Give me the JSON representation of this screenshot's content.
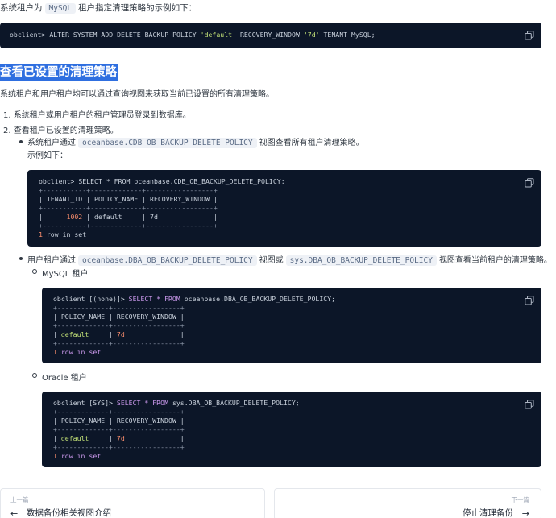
{
  "intro": {
    "prefix": "系统租户为",
    "code": "MySQL",
    "suffix": "租户指定清理策略的示例如下："
  },
  "code1": {
    "prompt": "obclient>",
    "sql": "ALTER SYSTEM ADD DELETE BACKUP POLICY",
    "str1": "'default'",
    "mid": "RECOVERY_WINDOW",
    "str2": "'7d'",
    "tail": "TENANT MySQL;"
  },
  "section_heading": "查看已设置的清理策略",
  "section_desc": "系统租户和用户租户均可以通过查询视图来获取当前已设置的所有清理策略。",
  "steps": [
    {
      "num": "1.",
      "text": "系统租户或用户租户的租户管理员登录到数据库。"
    },
    {
      "num": "2.",
      "text": "查看租户已设置的清理策略。"
    }
  ],
  "sys_tenant": {
    "prefix": "系统租户通过",
    "view": "oceanbase.CDB_OB_BACKUP_DELETE_POLICY",
    "suffix": "视图查看所有租户清理策略。",
    "example": "示例如下："
  },
  "code2": {
    "prompt": "obclient>",
    "sql": "SELECT * FROM oceanbase.CDB_OB_BACKUP_DELETE_POLICY;",
    "border": "+-----------+-------------+-----------------+",
    "header": "| TENANT_ID | POLICY_NAME | RECOVERY_WINDOW |",
    "row_pre": "|      ",
    "row_id": "1002",
    "row_post": " | default     | 7d              |",
    "count": "1",
    "count_text": " row in set"
  },
  "user_tenant": {
    "prefix": "用户租户通过",
    "view1": "oceanbase.DBA_OB_BACKUP_DELETE_POLICY",
    "mid": "视图或",
    "view2": "sys.DBA_OB_BACKUP_DELETE_POLICY",
    "suffix": "视图查看当前租户的清理策略。"
  },
  "mysql_label": "MySQL 租户",
  "code3": {
    "prompt": "obclient [(none)]>",
    "kw1": "SELECT",
    "star": "*",
    "kw2": "FROM",
    "tail": "oceanbase.DBA_OB_BACKUP_DELETE_POLICY;",
    "border": "+-------------+-----------------+",
    "header": "| POLICY_NAME | RECOVERY_WINDOW |",
    "row_default": "default",
    "row_7d": "7d",
    "count": "1",
    "row_text": "row",
    "in_text": "in",
    "set_text": "set"
  },
  "oracle_label": "Oracle 租户",
  "code4": {
    "prompt": "obclient [SYS]>",
    "kw1": "SELECT",
    "star": "*",
    "kw2": "FROM",
    "tail": "sys.DBA_OB_BACKUP_DELETE_POLICY;",
    "border": "+-------------+-----------------+",
    "header": "| POLICY_NAME | RECOVERY_WINDOW |",
    "row_default": "default",
    "row_7d": "7d",
    "count": "1",
    "row_text": "row",
    "in_text": "in",
    "set_text": "set"
  },
  "nav": {
    "prev_label": "上一篇",
    "prev_title": "数据备份相关视图介绍",
    "next_label": "下一篇",
    "next_title": "停止清理备份"
  },
  "colors": {
    "code_bg": "#0c1628",
    "heading_bg": "#2f6fe0",
    "keyword": "#ce9bf0",
    "string": "#c5e478",
    "number": "#f78c6c"
  },
  "icons": [
    "copy-icon",
    "arrow-left-icon",
    "arrow-right-icon"
  ]
}
